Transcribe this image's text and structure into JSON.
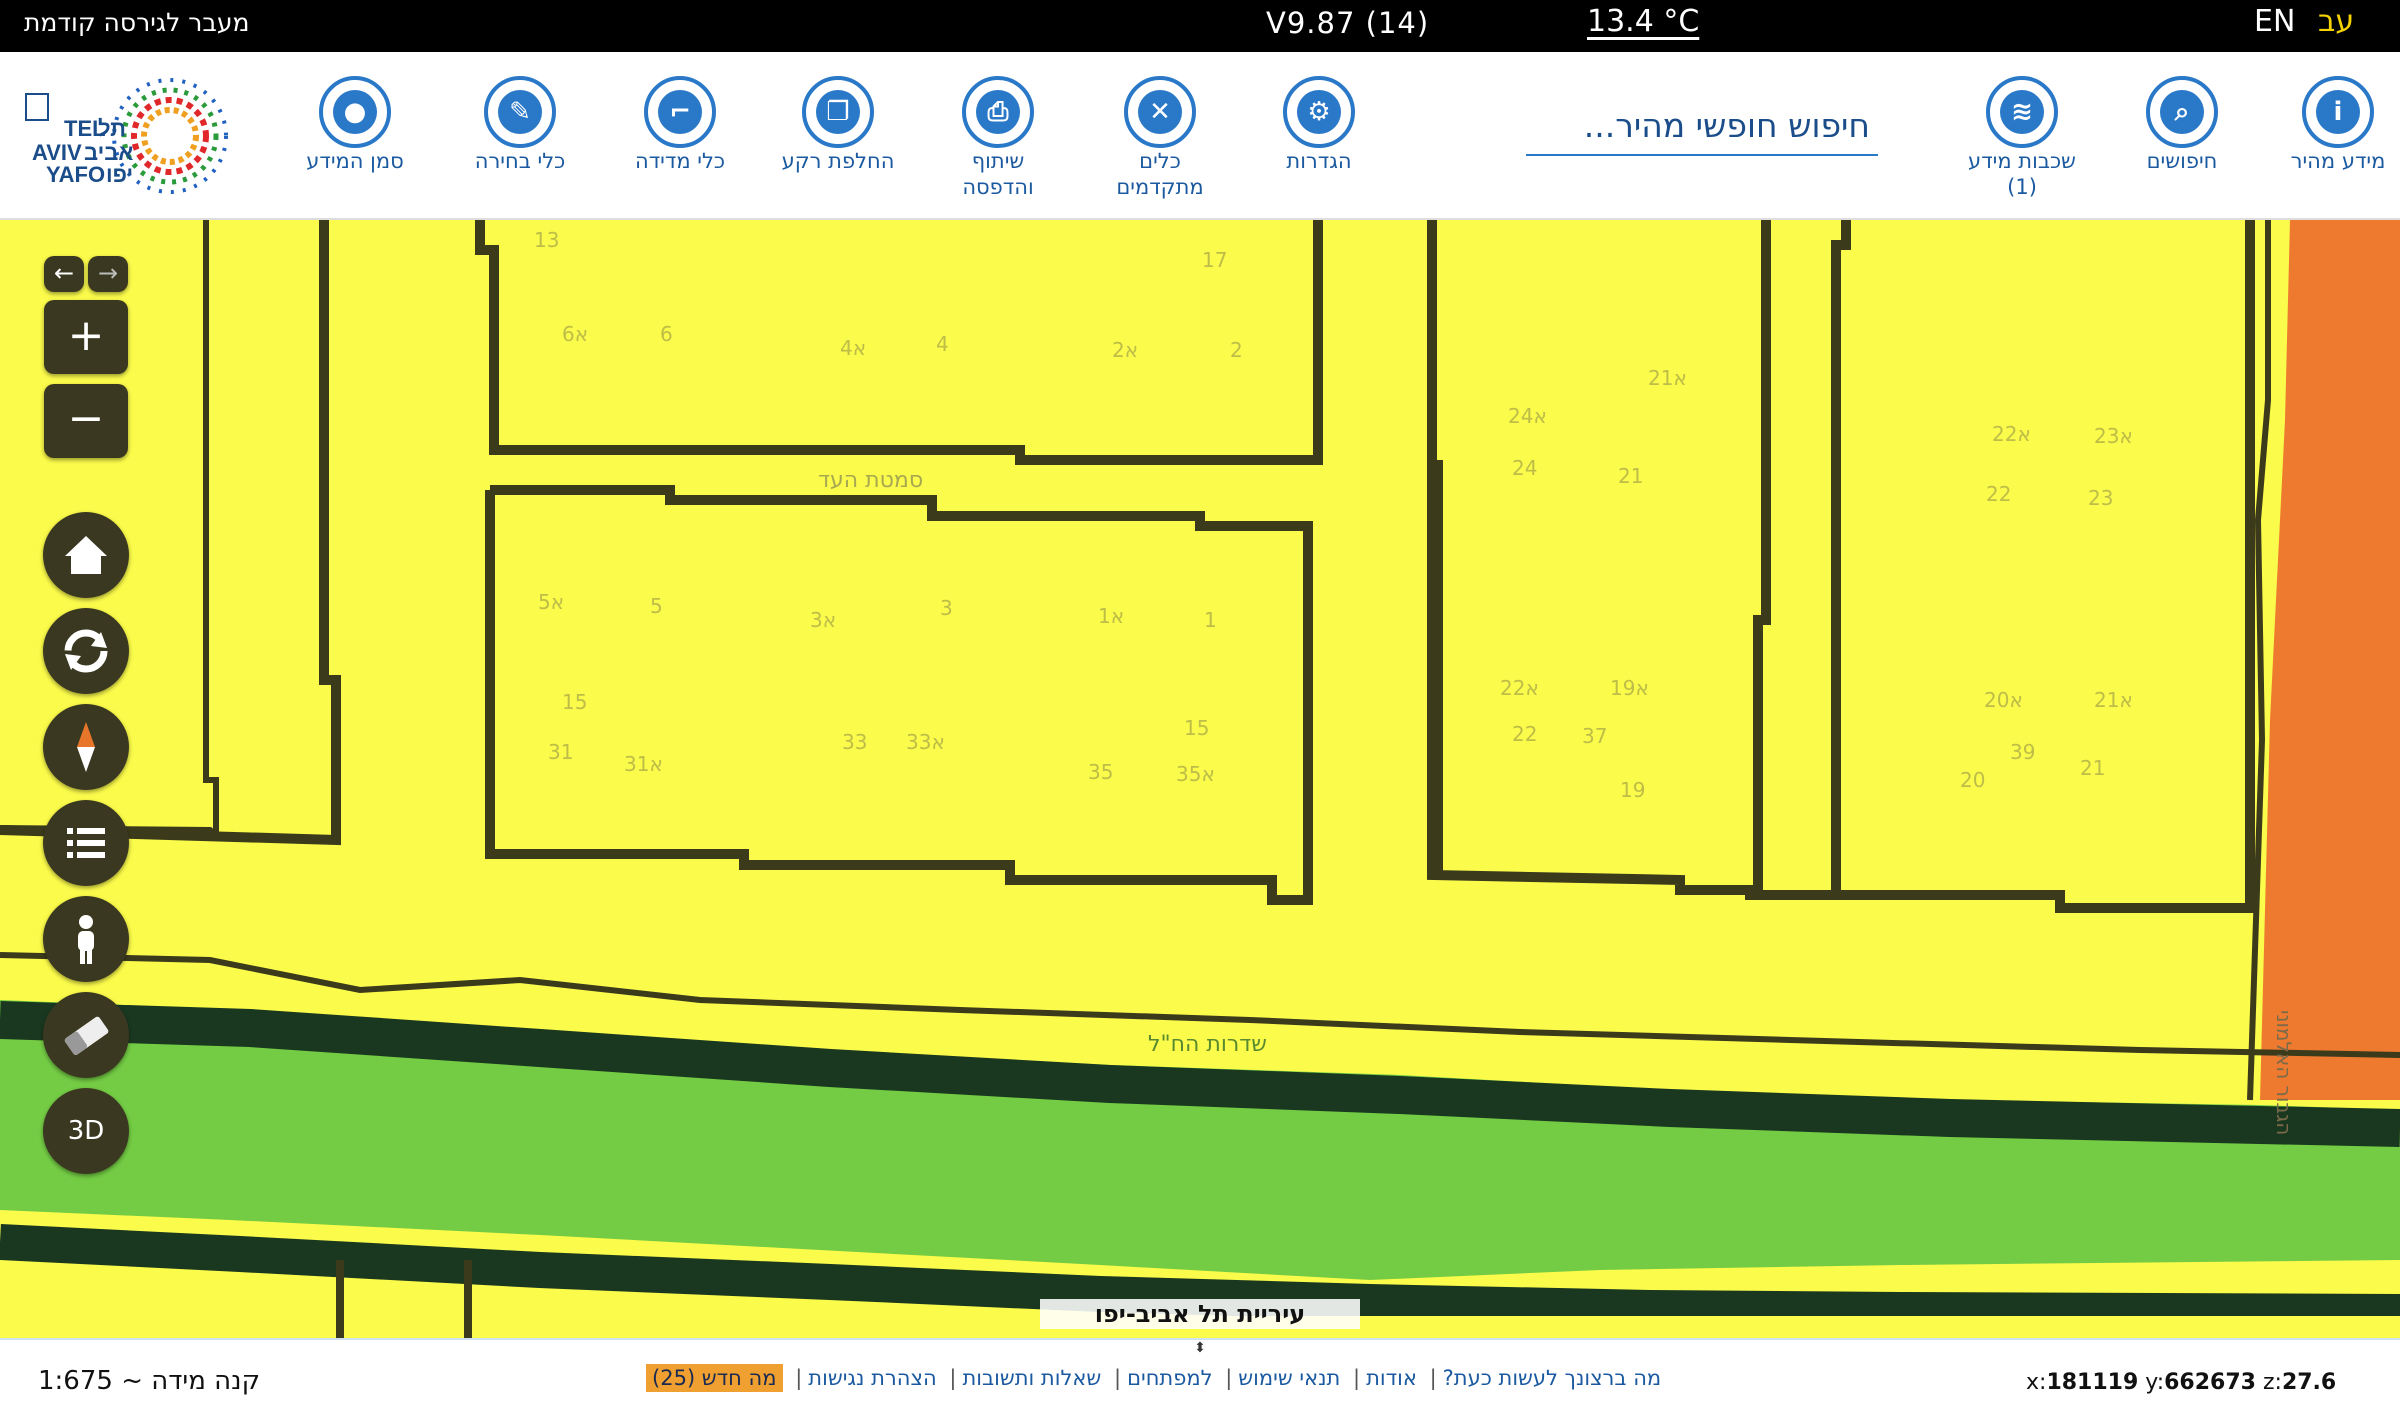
{
  "topbar": {
    "prev_version_link": "מעבר לגירסה קודמת",
    "version": "V9.87 (14)",
    "temperature": "13.4 °C",
    "lang_en": "EN",
    "lang_he": "עב"
  },
  "toolbar": {
    "logo_text": [
      "TEL",
      "AVIV",
      "YAFO",
      "תל",
      "אביב",
      "יפו"
    ],
    "tools": [
      {
        "id": "quick-info",
        "label": "מידע מהיר",
        "icon": "info-icon",
        "glyph": "i"
      },
      {
        "id": "searches",
        "label": "חיפושים",
        "icon": "search-icon",
        "glyph": "⌕"
      },
      {
        "id": "layers",
        "label": "שכבות מידע\n(1)",
        "icon": "layers-icon",
        "glyph": "≋"
      },
      {
        "id": "settings",
        "label": "הגדרות",
        "icon": "gear-icon",
        "glyph": "⚙"
      },
      {
        "id": "advanced-tools",
        "label": "כלים\nמתקדמים",
        "icon": "tools-icon",
        "glyph": "✕"
      },
      {
        "id": "share-print",
        "label": "שיתוף\nוהדפסה",
        "icon": "print-icon",
        "glyph": "⎙"
      },
      {
        "id": "basemap",
        "label": "החלפת רקע",
        "icon": "basemap-icon",
        "glyph": "❐"
      },
      {
        "id": "measure",
        "label": "כלי מדידה",
        "icon": "ruler-icon",
        "glyph": "⌐"
      },
      {
        "id": "select",
        "label": "כלי בחירה",
        "icon": "select-icon",
        "glyph": "✎"
      },
      {
        "id": "mark-info",
        "label": "סמן המידע",
        "icon": "pin-icon",
        "glyph": "⬇"
      }
    ],
    "search_placeholder": "חיפוש חופשי מהיר..."
  },
  "map_controls": {
    "zoom_in": "+",
    "zoom_out": "−",
    "three_d": "3D"
  },
  "map_labels": {
    "city": "עיריית תל אביב-יפו",
    "streets": [
      "סמטת העד",
      "שדרות הח\"ל",
      "הגבור האלמוני"
    ],
    "parcels": [
      "13",
      "17",
      "א6",
      "6",
      "א4",
      "4",
      "א2",
      "2",
      "א21",
      "א24",
      "24",
      "21",
      "א22",
      "א23",
      "22",
      "23",
      "א5",
      "5",
      "א3",
      "3",
      "א1",
      "1",
      "15",
      "31",
      "א31",
      "33",
      "א33",
      "15",
      "35",
      "א35",
      "א22",
      "א19",
      "22",
      "37",
      "19",
      "א20",
      "א21",
      "39",
      "21",
      "20"
    ]
  },
  "bottombar": {
    "scale": "קנה מידה ~ 1:675",
    "links": [
      "מה ברצונך לעשות כעת?",
      "אודות",
      "תנאי שימוש",
      "למפתחים",
      "שאלות ותשובות",
      "הצהרת נגישות"
    ],
    "whats_new": "מה חדש (25)",
    "coords": {
      "x": "181119",
      "y": "662673",
      "z": "27.6"
    }
  },
  "colors": {
    "parcel_fill": "#fbfb4b",
    "road": "#74cc44",
    "road_edge": "#1a3820",
    "boundary": "#3b3b1c",
    "accent": "#2a78c8",
    "orange_road": "#ee7a30"
  }
}
